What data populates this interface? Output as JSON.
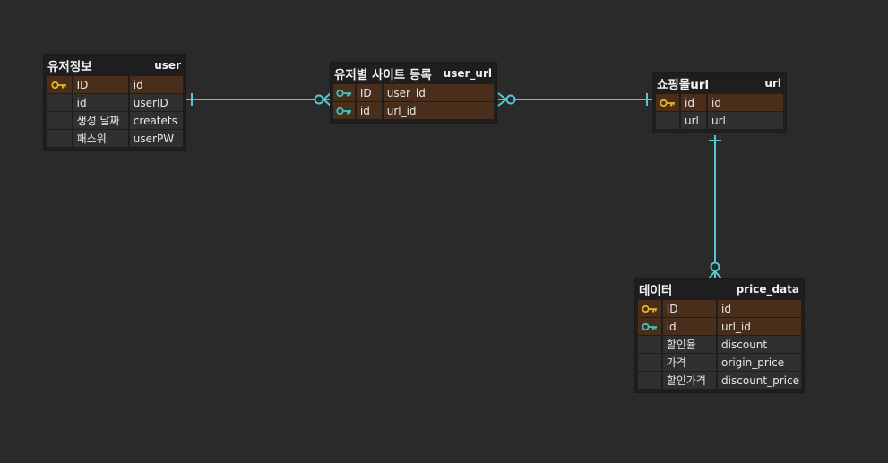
{
  "colors": {
    "background": "#2a2a2a",
    "entity_bg": "#1e1e1e",
    "row_bg": "#303030",
    "key_row_bg": "#4a2e1c",
    "primary_key_icon": "#e6b422",
    "foreign_key_icon": "#3fc5c0",
    "connector": "#56c6d0"
  },
  "entities": {
    "user": {
      "title": "유저정보",
      "table": "user",
      "rows": [
        {
          "logical": "ID",
          "physical": "id",
          "key": "pk"
        },
        {
          "logical": "id",
          "physical": "userID",
          "key": ""
        },
        {
          "logical": "생성 날짜",
          "physical": "createts",
          "key": ""
        },
        {
          "logical": "패스워",
          "physical": "userPW",
          "key": ""
        }
      ]
    },
    "user_url": {
      "title": "유저별 사이트 등록",
      "table": "user_url",
      "rows": [
        {
          "logical": "ID",
          "physical": "user_id",
          "key": "fk"
        },
        {
          "logical": "id",
          "physical": "url_id",
          "key": "fk"
        }
      ]
    },
    "url": {
      "title": "쇼핑몰url",
      "table": "url",
      "rows": [
        {
          "logical": "id",
          "physical": "id",
          "key": "pk"
        },
        {
          "logical": "url",
          "physical": "url",
          "key": ""
        }
      ]
    },
    "price_data": {
      "title": "데이터",
      "table": "price_data",
      "rows": [
        {
          "logical": "ID",
          "physical": "id",
          "key": "pk"
        },
        {
          "logical": "id",
          "physical": "url_id",
          "key": "fk"
        },
        {
          "logical": "할인율",
          "physical": "discount",
          "key": ""
        },
        {
          "logical": "가격",
          "physical": "origin_price",
          "key": ""
        },
        {
          "logical": "할인가격",
          "physical": "discount_price",
          "key": ""
        }
      ]
    }
  },
  "relationships": [
    {
      "from": "user",
      "to": "user_url",
      "from_cardinality": "one",
      "to_cardinality": "zero-or-many"
    },
    {
      "from": "url",
      "to": "user_url",
      "from_cardinality": "one",
      "to_cardinality": "zero-or-many"
    },
    {
      "from": "url",
      "to": "price_data",
      "from_cardinality": "one",
      "to_cardinality": "zero-or-many"
    }
  ]
}
